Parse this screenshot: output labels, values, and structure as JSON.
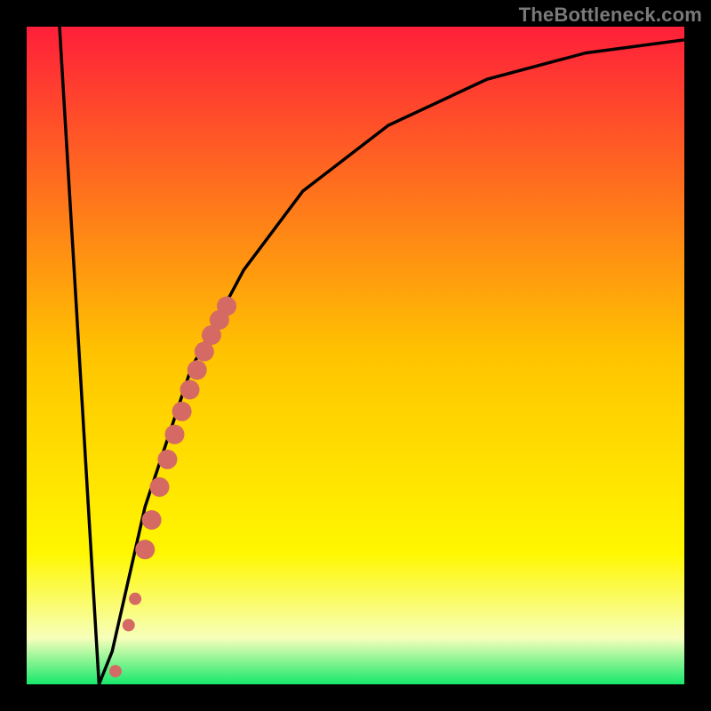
{
  "attribution": {
    "text": "TheBottleneck.com"
  },
  "colors": {
    "marker": "#d46a63",
    "curve": "#000000",
    "top": "#ff1f3a",
    "mid": "#ffc400",
    "yellow": "#fff700",
    "pale": "#f7ffba",
    "green": "#17e86b",
    "frame": "#000000"
  },
  "chart_data": {
    "type": "line",
    "x": [
      0.05,
      0.11,
      0.13,
      0.18,
      0.25,
      0.33,
      0.42,
      0.55,
      0.7,
      0.85,
      1.0
    ],
    "y": [
      1.0,
      0.0,
      0.05,
      0.27,
      0.48,
      0.63,
      0.75,
      0.85,
      0.92,
      0.96,
      0.98
    ],
    "title": "",
    "xlabel": "",
    "ylabel": "",
    "xlim": [
      0,
      1
    ],
    "ylim": [
      0,
      1
    ],
    "markers": {
      "type": "scatter",
      "x": [
        0.135,
        0.155,
        0.165,
        0.18,
        0.19,
        0.202,
        0.214,
        0.225,
        0.236,
        0.248,
        0.259,
        0.27,
        0.281,
        0.293,
        0.304
      ],
      "y": [
        0.02,
        0.09,
        0.13,
        0.205,
        0.25,
        0.3,
        0.342,
        0.38,
        0.415,
        0.448,
        0.478,
        0.506,
        0.531,
        0.554,
        0.575
      ]
    }
  }
}
